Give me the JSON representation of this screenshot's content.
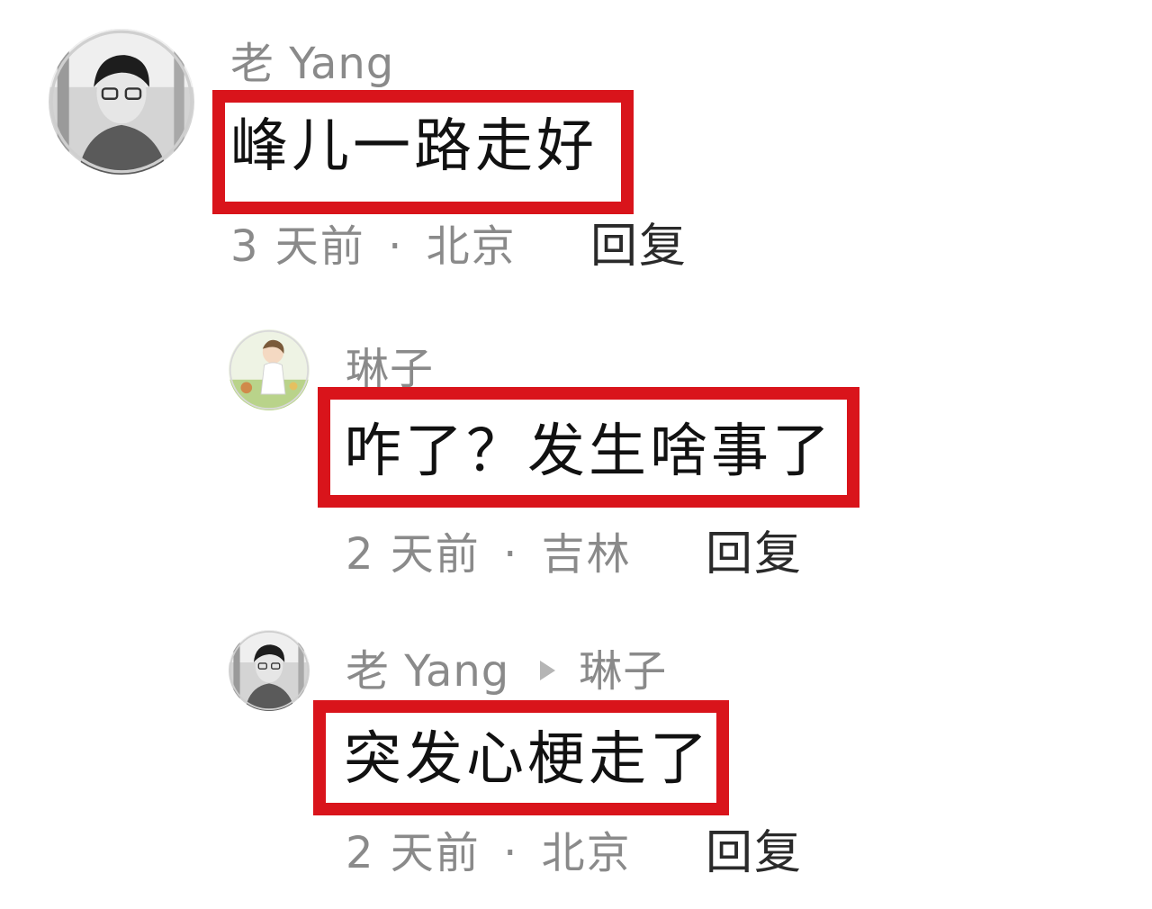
{
  "comments": [
    {
      "author": "老 Yang",
      "body": "峰儿一路走好",
      "time": "3 天前",
      "separator": "·",
      "location": "北京",
      "reply_label": "回复"
    },
    {
      "author": "琳子",
      "body": "咋了？发生啥事了",
      "time": "2 天前",
      "separator": "·",
      "location": "吉林",
      "reply_label": "回复"
    },
    {
      "author": "老 Yang",
      "reply_to": "琳子",
      "body": "突发心梗走了",
      "time": "2 天前",
      "separator": "·",
      "location": "北京",
      "reply_label": "回复"
    }
  ],
  "colors": {
    "highlight_border": "#d9141b",
    "author_text": "#8a8a8a",
    "body_text": "#111111",
    "meta_text": "#8a8a8a",
    "reply_text": "#2a2a2a"
  },
  "icons": {
    "reply_to_arrow": "triangle-right-icon"
  }
}
